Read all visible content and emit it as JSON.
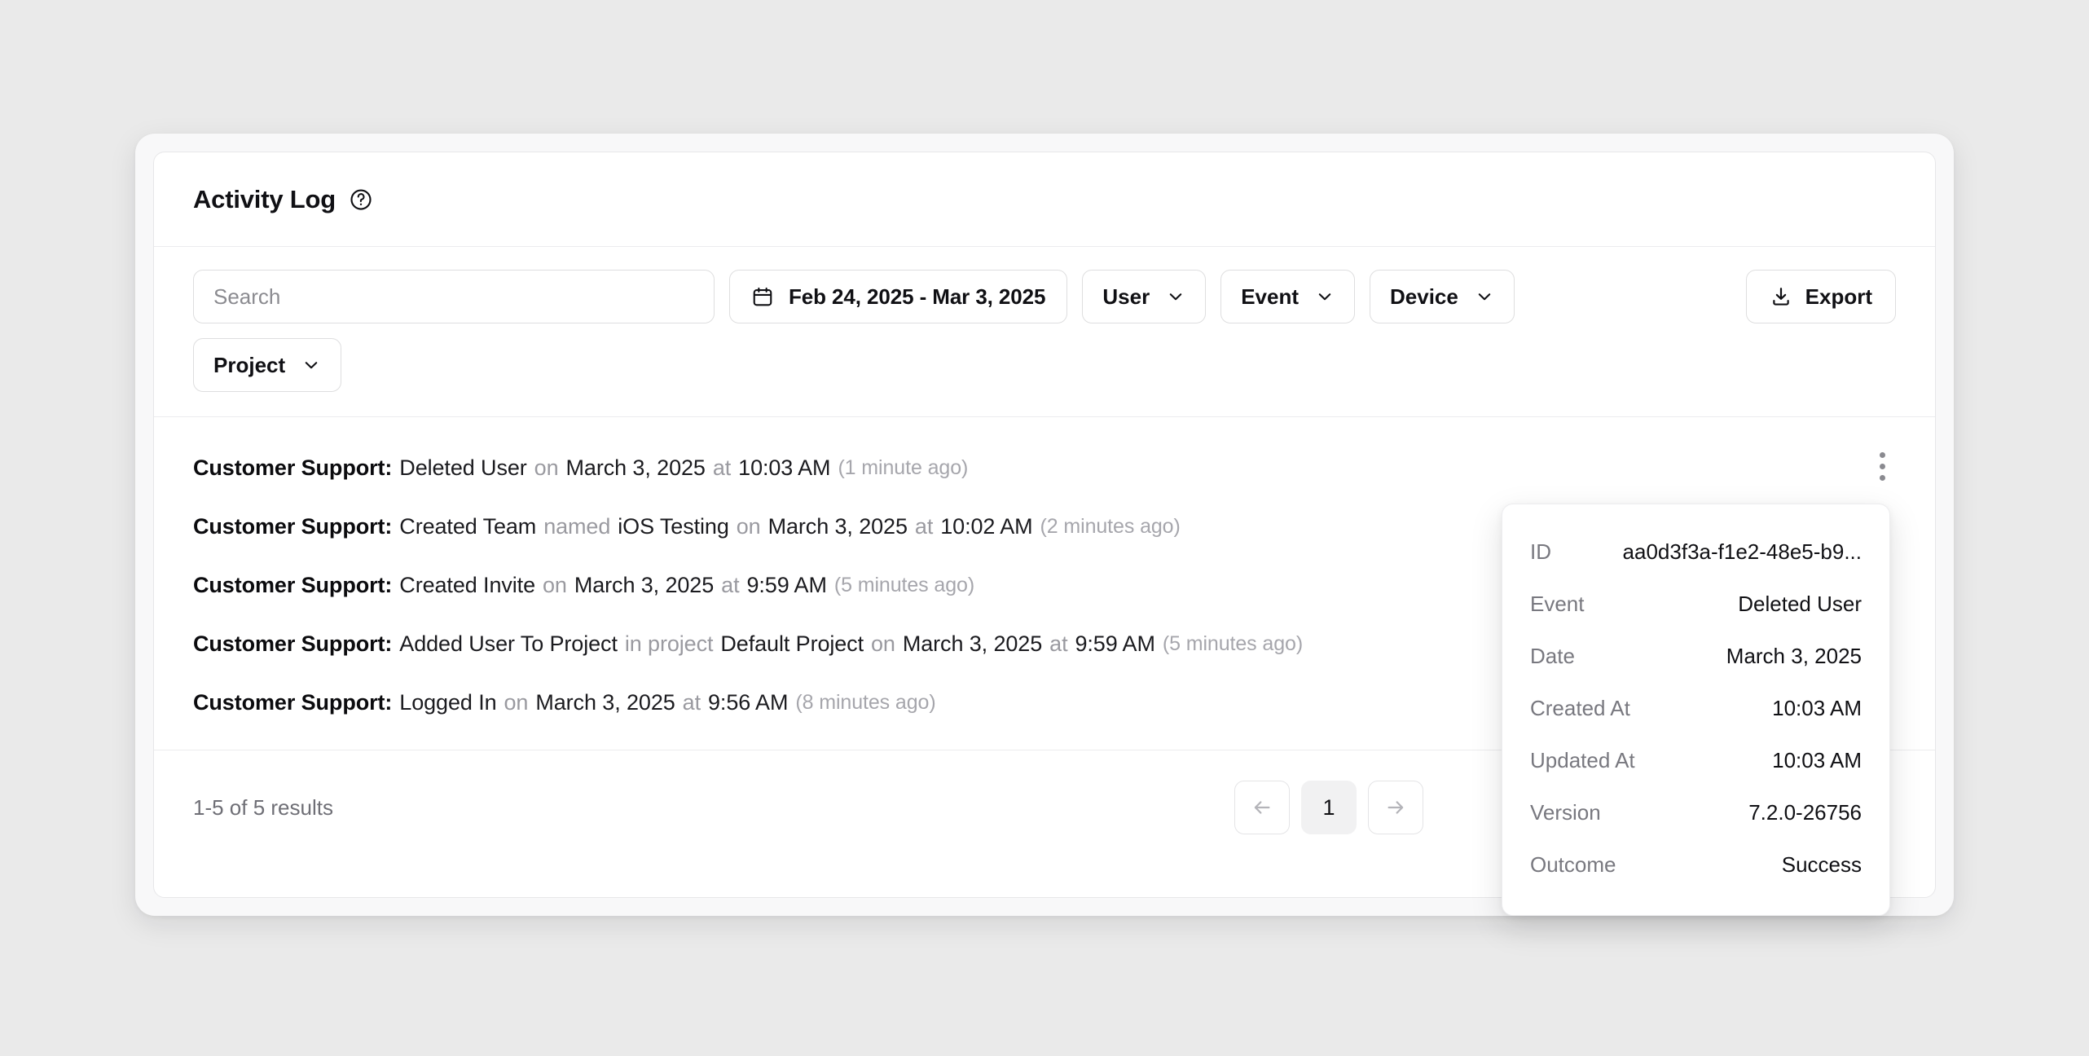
{
  "header": {
    "title": "Activity Log",
    "help_icon": "question-circle-icon"
  },
  "toolbar": {
    "search": {
      "placeholder": "Search",
      "value": "",
      "icon": "search-input"
    },
    "date_range": {
      "label": "Feb 24, 2025 - Mar 3, 2025",
      "icon": "calendar-icon"
    },
    "filters": [
      {
        "label": "User",
        "icon": "chevron-down-icon"
      },
      {
        "label": "Event",
        "icon": "chevron-down-icon"
      },
      {
        "label": "Device",
        "icon": "chevron-down-icon"
      },
      {
        "label": "Project",
        "icon": "chevron-down-icon"
      }
    ],
    "export": {
      "label": "Export",
      "icon": "download-icon"
    }
  },
  "log": {
    "kebab_icon": "more-vertical-icon",
    "rows": [
      {
        "actor": "Customer Support:",
        "event": "Deleted User",
        "mid_label": "",
        "mid_value": "",
        "on": "on",
        "date": "March 3, 2025",
        "at": "at",
        "time": "10:03 AM",
        "ago": "(1 minute ago)"
      },
      {
        "actor": "Customer Support:",
        "event": "Created Team",
        "mid_label": "named",
        "mid_value": "iOS Testing",
        "on": "on",
        "date": "March 3, 2025",
        "at": "at",
        "time": "10:02 AM",
        "ago": "(2 minutes ago)"
      },
      {
        "actor": "Customer Support:",
        "event": "Created Invite",
        "mid_label": "",
        "mid_value": "",
        "on": "on",
        "date": "March 3, 2025",
        "at": "at",
        "time": "9:59 AM",
        "ago": "(5 minutes ago)"
      },
      {
        "actor": "Customer Support:",
        "event": "Added User To Project",
        "mid_label": "in project",
        "mid_value": "Default Project",
        "on": "on",
        "date": "March 3, 2025",
        "at": "at",
        "time": "9:59 AM",
        "ago": "(5 minutes ago)"
      },
      {
        "actor": "Customer Support:",
        "event": "Logged In",
        "mid_label": "",
        "mid_value": "",
        "on": "on",
        "date": "March 3, 2025",
        "at": "at",
        "time": "9:56 AM",
        "ago": "(8 minutes ago)"
      }
    ]
  },
  "footer": {
    "results": "1-5 of 5 results",
    "prev_icon": "arrow-left-icon",
    "next_icon": "arrow-right-icon",
    "current_page": "1"
  },
  "popover": {
    "rows": [
      {
        "label": "ID",
        "value": "aa0d3f3a-f1e2-48e5-b9..."
      },
      {
        "label": "Event",
        "value": "Deleted User"
      },
      {
        "label": "Date",
        "value": "March 3, 2025"
      },
      {
        "label": "Created At",
        "value": "10:03 AM"
      },
      {
        "label": "Updated At",
        "value": "10:03 AM"
      },
      {
        "label": "Version",
        "value": "7.2.0-26756"
      },
      {
        "label": "Outcome",
        "value": "Success"
      }
    ]
  },
  "colors": {
    "page_bg": "#eaeaea",
    "card_bg": "#ffffff",
    "outer_bg": "#f8f8f9",
    "text": "#101014",
    "muted": "#9a9aa0",
    "border": "#e7e7e9"
  }
}
